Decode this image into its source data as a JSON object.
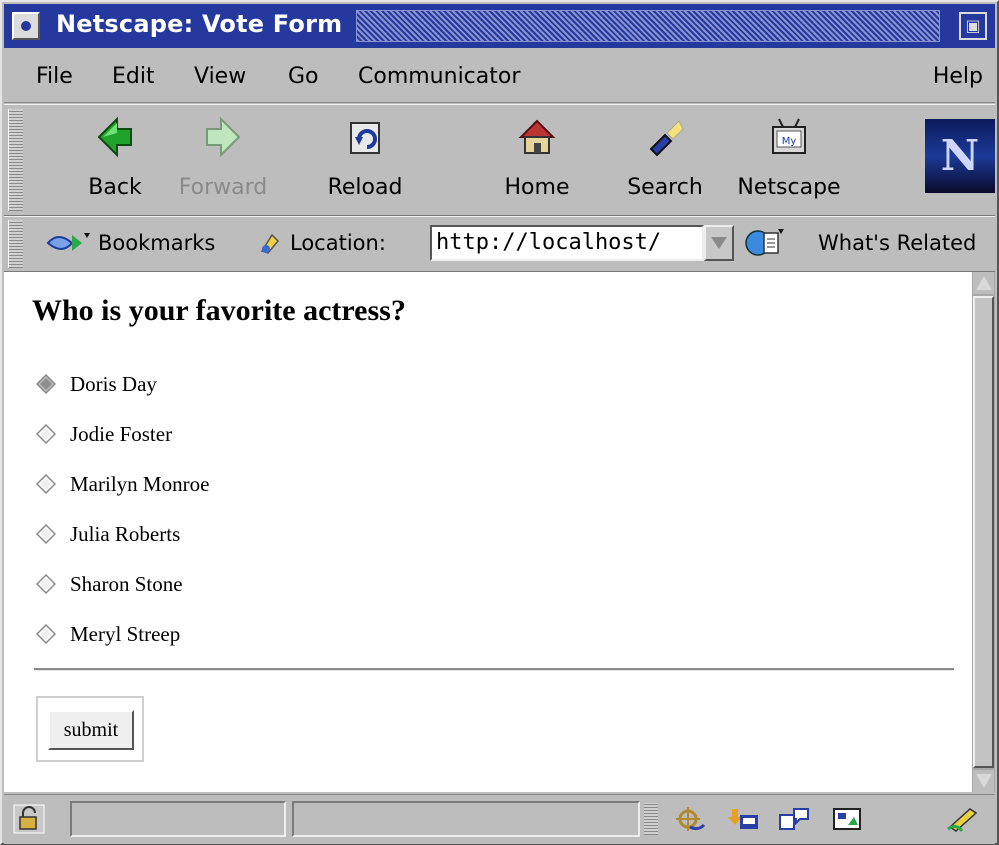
{
  "window": {
    "title": "Netscape: Vote Form"
  },
  "menu": {
    "items": [
      "File",
      "Edit",
      "View",
      "Go",
      "Communicator"
    ],
    "help": "Help"
  },
  "toolbar": {
    "back": "Back",
    "forward": "Forward",
    "reload": "Reload",
    "home": "Home",
    "search": "Search",
    "netscape": "Netscape"
  },
  "location": {
    "bookmarks": "Bookmarks",
    "label": "Location:",
    "url": "http://localhost/",
    "whats_related": "What's Related"
  },
  "page": {
    "heading": "Who is your favorite actress?",
    "options": [
      "Doris Day",
      "Jodie Foster",
      "Marilyn Monroe",
      "Julia Roberts",
      "Sharon Stone",
      "Meryl Streep"
    ],
    "selected_index": 0,
    "submit": "submit"
  },
  "colors": {
    "titlebar": "#24389e",
    "chrome": "#bdbdbd",
    "page_bg": "#ffffff"
  }
}
